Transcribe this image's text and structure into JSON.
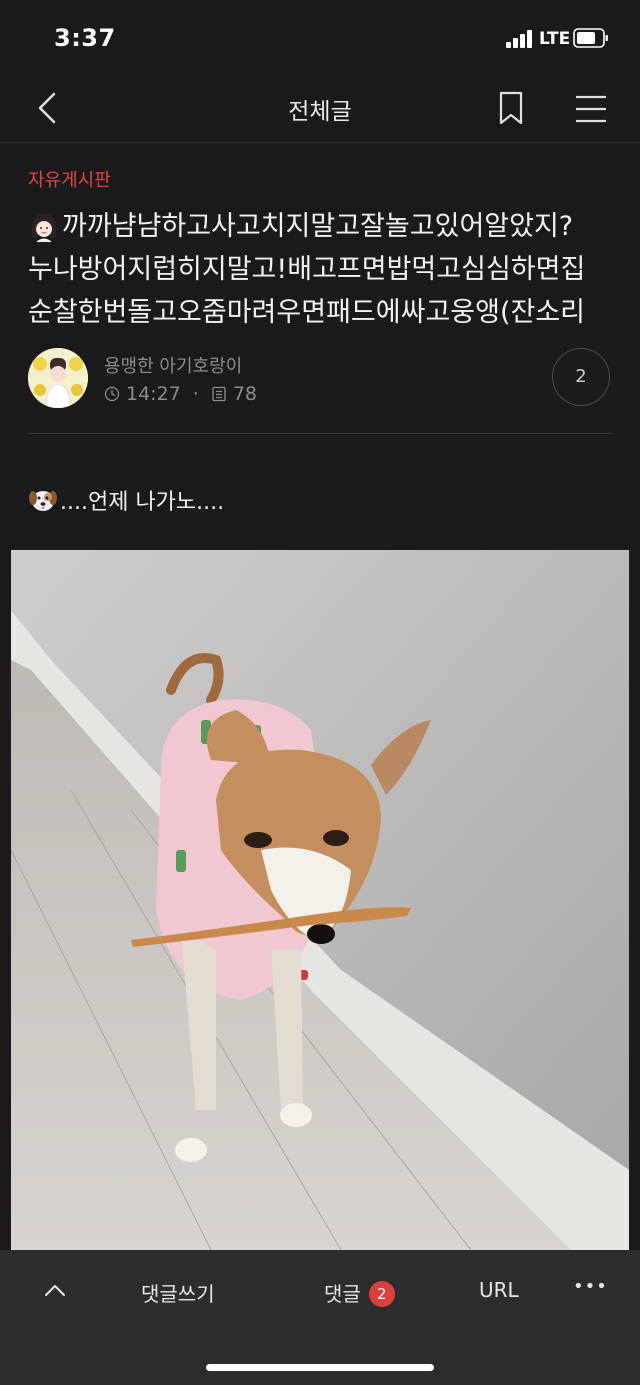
{
  "status_bar": {
    "time": "3:37",
    "network": "LTE"
  },
  "nav": {
    "title": "전체글"
  },
  "post": {
    "category": "자유게시판",
    "title_lines": [
      "까까냠냠하고사고치지말고잘놀고있어알았지?",
      "누나방어지럽히지말고!배고프면밥먹고심심하면집",
      "순찰한번돌고오줌마려우면패드에싸고웅앵(잔소리"
    ],
    "author": "용맹한 아기호랑이",
    "time": "14:27",
    "views": "78",
    "comment_count": "2",
    "body_text": "....언제 나가노...."
  },
  "toolbar": {
    "write_comment": "댓글쓰기",
    "comments_label": "댓글",
    "comments_badge": "2",
    "url_label": "URL",
    "more_label": "•••"
  },
  "colors": {
    "background": "#1a1a1c",
    "accent": "#e2473e",
    "badge": "#d8403a",
    "toolbar": "#2d2d30"
  }
}
